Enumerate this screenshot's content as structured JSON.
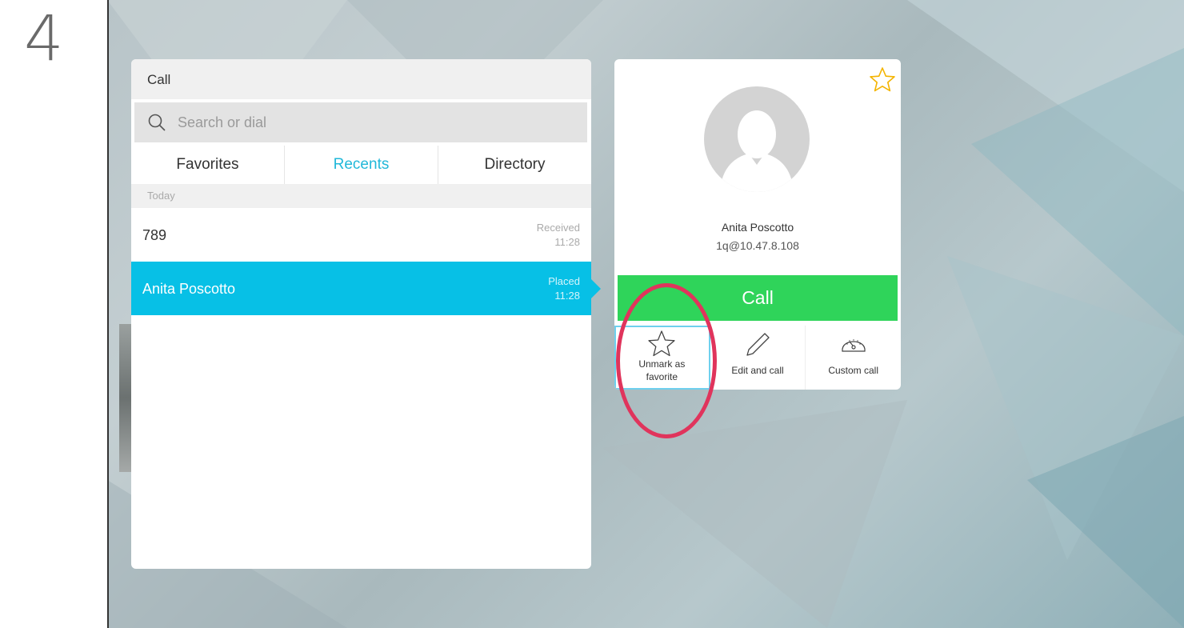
{
  "step_number": "4",
  "call_panel": {
    "title": "Call",
    "search_placeholder": "Search or dial",
    "tabs": [
      {
        "label": "Favorites",
        "active": false
      },
      {
        "label": "Recents",
        "active": true
      },
      {
        "label": "Directory",
        "active": false
      }
    ],
    "section_label": "Today",
    "recents": [
      {
        "name": "789",
        "status": "Received",
        "time": "11:28",
        "selected": false
      },
      {
        "name": "Anita Poscotto",
        "status": "Placed",
        "time": "11:28",
        "selected": true
      }
    ]
  },
  "contact_card": {
    "favorite_icon": "star-icon",
    "name": "Anita Poscotto",
    "address": "1q@10.47.8.108",
    "call_label": "Call",
    "actions": [
      {
        "label_line1": "Unmark as",
        "label_line2": "favorite",
        "icon": "star-outline-icon"
      },
      {
        "label_line1": "Edit and call",
        "label_line2": "",
        "icon": "pencil-icon"
      },
      {
        "label_line1": "Custom call",
        "label_line2": "",
        "icon": "dial-gauge-icon"
      }
    ]
  },
  "colors": {
    "accent": "#07c0e6",
    "call_green": "#2fd45a",
    "favorite_star": "#f4b400",
    "highlight": "#e0345c"
  }
}
